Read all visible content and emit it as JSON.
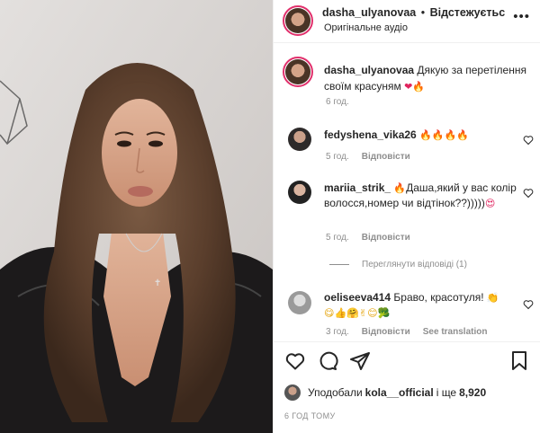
{
  "header": {
    "username": "dasha_ulyanovaa",
    "separator": "•",
    "follow_label": "Відстежуєтьс",
    "audio_label": "Оригінальне аудіо",
    "more_label": "•••"
  },
  "caption": {
    "username": "dasha_ulyanovaa",
    "text": "Дякую за перетілення своїм красуням",
    "emojis": "❤🔥",
    "time": "6 год."
  },
  "comments": [
    {
      "username": "fedyshena_vika26",
      "text": "",
      "emojis": "🔥🔥🔥🔥",
      "time": "5 год.",
      "reply_label": "Відповісти"
    },
    {
      "username": "mariia_strik_",
      "text": "Даша,який у вас колір волосся,номер чи відтінок??)))))",
      "emoji_pre": "🔥",
      "emojis": "😍",
      "time": "5 год.",
      "reply_label": "Відповісти"
    },
    {
      "username": "oeliseeva414",
      "text": "Браво, красотуля!",
      "emojis": "👏",
      "emoji_line": "😋👍🤗✌😊🥦",
      "time": "3 год.",
      "reply_label": "Відповісти",
      "translation_label": "See translation"
    }
  ],
  "view_replies_label": "Переглянути відповіді (1)",
  "likes": {
    "prefix": "Уподобали",
    "user": "kola__official",
    "middle": "і ще",
    "count": "8,920"
  },
  "posted": "6 ГОД ТОМУ",
  "icons": [
    "heart-icon",
    "comment-icon",
    "share-icon",
    "bookmark-icon"
  ]
}
